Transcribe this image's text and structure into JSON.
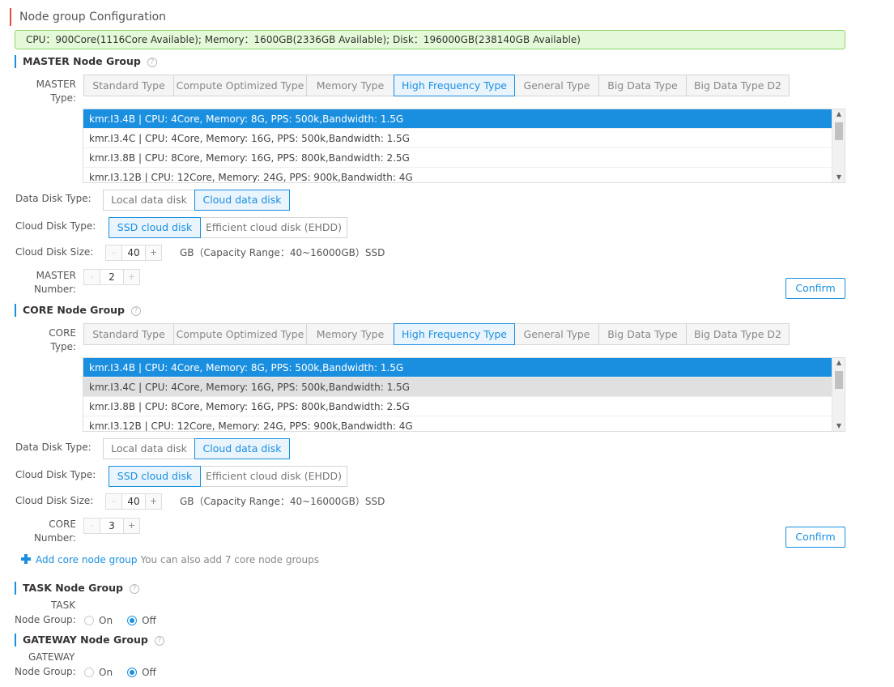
{
  "page": {
    "title": "Node group Configuration",
    "summary": "CPU：900Core(1116Core Available); Memory：1600GB(2336GB Available); Disk：196000GB(238140GB Available)"
  },
  "common": {
    "data_disk_type_label": "Data Disk Type:",
    "cloud_disk_type_label": "Cloud Disk Type:",
    "cloud_disk_size_label": "Cloud Disk Size:",
    "help_glyph": "?",
    "minus": "-",
    "plus": "+",
    "confirm": "Confirm",
    "on": "On",
    "off": "Off",
    "node_group_label": "Node Group:"
  },
  "master": {
    "title": "MASTER Node Group",
    "type_label_1": "MASTER",
    "type_label_2": "Type:",
    "instance_types": [
      "Standard Type",
      "Compute Optimized Type",
      "Memory Type",
      "High Frequency Type",
      "General Type",
      "Big Data Type",
      "Big Data Type D2"
    ],
    "active_type": "High Frequency Type",
    "instances": [
      "kmr.I3.4B | CPU: 4Core, Memory: 8G, PPS: 500k,Bandwidth: 1.5G",
      "kmr.I3.4C | CPU: 4Core, Memory: 16G, PPS: 500k,Bandwidth: 1.5G",
      "kmr.I3.8B | CPU: 8Core, Memory: 16G, PPS: 800k,Bandwidth: 2.5G",
      "kmr.I3.12B | CPU: 12Core, Memory: 24G, PPS: 900k,Bandwidth: 4G"
    ],
    "data_disk_options": [
      "Local data disk",
      "Cloud data disk"
    ],
    "cloud_disk_options": [
      "SSD cloud disk",
      "Efficient cloud disk (EHDD)"
    ],
    "disk_size": "40",
    "disk_unit": "GB（Capacity Range：40~16000GB）SSD",
    "number_label_1": "MASTER",
    "number_label_2": "Number:",
    "number": "2"
  },
  "core": {
    "title": "CORE Node Group",
    "type_label_1": "CORE",
    "type_label_2": "Type:",
    "instance_types": [
      "Standard Type",
      "Compute Optimized Type",
      "Memory Type",
      "High Frequency Type",
      "General Type",
      "Big Data Type",
      "Big Data Type D2"
    ],
    "active_type": "High Frequency Type",
    "instances": [
      "kmr.I3.4B | CPU: 4Core, Memory: 8G, PPS: 500k,Bandwidth: 1.5G",
      "kmr.I3.4C | CPU: 4Core, Memory: 16G, PPS: 500k,Bandwidth: 1.5G",
      "kmr.I3.8B | CPU: 8Core, Memory: 16G, PPS: 800k,Bandwidth: 2.5G",
      "kmr.I3.12B | CPU: 12Core, Memory: 24G, PPS: 900k,Bandwidth: 4G"
    ],
    "data_disk_options": [
      "Local data disk",
      "Cloud data disk"
    ],
    "cloud_disk_options": [
      "SSD cloud disk",
      "Efficient cloud disk (EHDD)"
    ],
    "disk_size": "40",
    "disk_unit": "GB（Capacity Range：40~16000GB）SSD",
    "number_label_1": "CORE",
    "number_label_2": "Number:",
    "number": "3",
    "add_link": "Add core node group",
    "add_hint": "You can also add 7 core node groups"
  },
  "task": {
    "title": "TASK Node Group",
    "label_1": "TASK",
    "selected": "Off"
  },
  "gateway": {
    "title": "GATEWAY Node Group",
    "label_1": "GATEWAY",
    "selected": "Off"
  },
  "colors": {
    "accent": "#1a8fe0",
    "summary_bg": "#e4f9d8",
    "header_mark": "#e64b3c"
  }
}
